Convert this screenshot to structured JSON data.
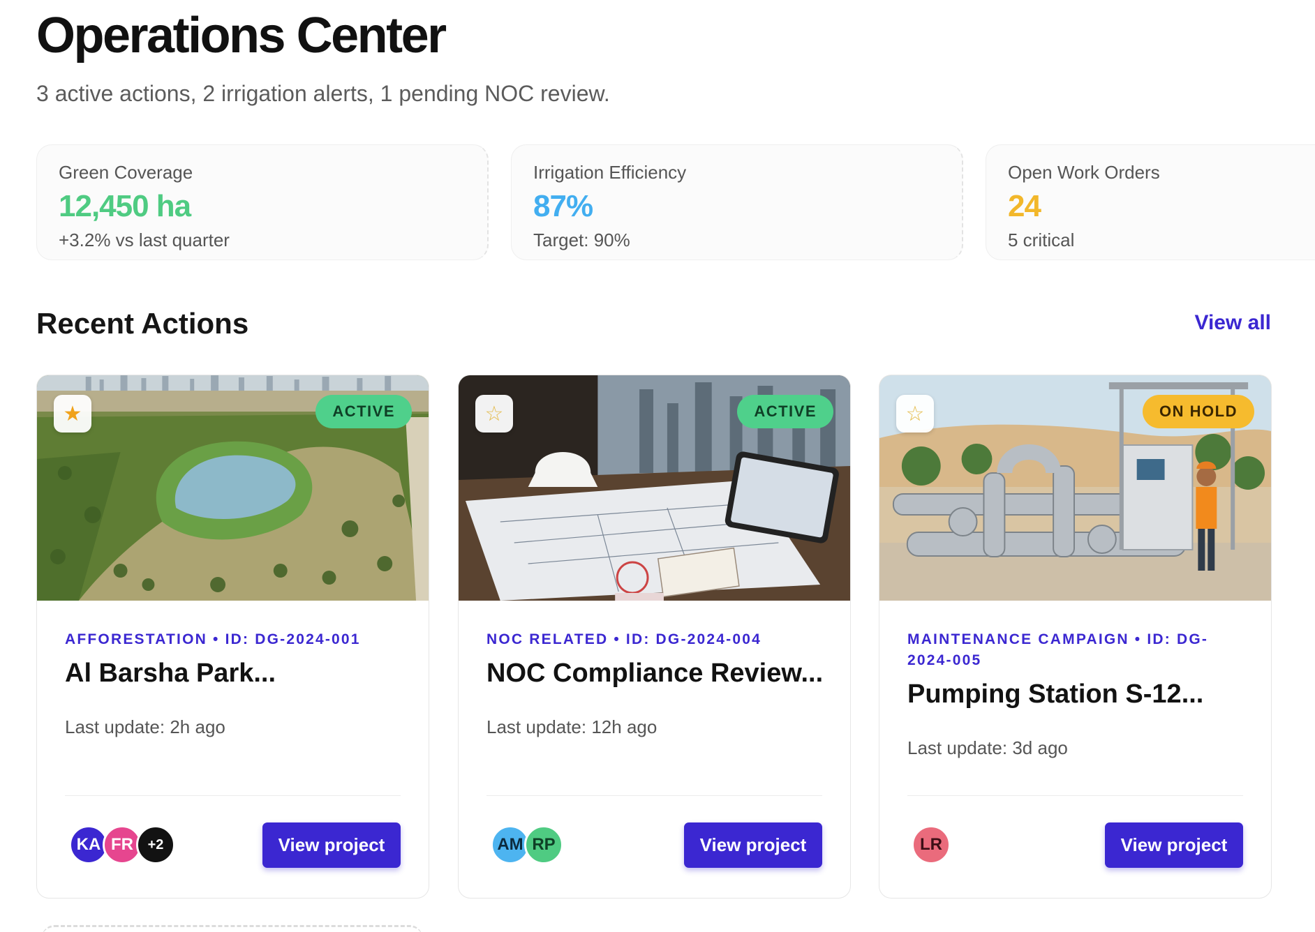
{
  "header": {
    "title": "Operations Center",
    "subtitle": "3 active actions, 2 irrigation alerts, 1 pending NOC review."
  },
  "stats": [
    {
      "label": "Green Coverage",
      "value": "12,450 ha",
      "note": "+3.2% vs last quarter",
      "color": "#4fcb82"
    },
    {
      "label": "Irrigation Efficiency",
      "value": "87%",
      "note": "Target: 90%",
      "color": "#42aef0"
    },
    {
      "label": "Open Work Orders",
      "value": "24",
      "note": "5 critical",
      "color": "#f2b72a"
    }
  ],
  "section": {
    "title": "Recent Actions",
    "view_all": "View all"
  },
  "cards": [
    {
      "image": "park-aerial-photo",
      "favorite": true,
      "status": "ACTIVE",
      "meta": "AFFORESTATION • ID: DG-2024-001",
      "title": "Al Barsha Park...",
      "update": "Last update: 2h ago",
      "avatars": [
        {
          "initials": "KA",
          "color": "#3b27d1"
        },
        {
          "initials": "FR",
          "color": "#e6468f"
        },
        {
          "initials": "+2",
          "color": "#121212"
        }
      ],
      "button": "View project"
    },
    {
      "image": "office-desk-blueprints-photo",
      "favorite": false,
      "status": "ACTIVE",
      "meta": "NOC RELATED • ID: DG-2024-004",
      "title": "NOC Compliance Review...",
      "update": "Last update: 12h ago",
      "avatars": [
        {
          "initials": "AM",
          "color": "#4db4f0"
        },
        {
          "initials": "RP",
          "color": "#4fcb82"
        }
      ],
      "button": "View project"
    },
    {
      "image": "pumping-station-photo",
      "favorite": false,
      "status": "ON HOLD",
      "meta": "MAINTENANCE CAMPAIGN • ID: DG-2024-005",
      "title": "Pumping Station S-12...",
      "update": "Last update: 3d ago",
      "avatars": [
        {
          "initials": "LR",
          "color": "#ea6b7c"
        }
      ],
      "button": "View project"
    }
  ]
}
